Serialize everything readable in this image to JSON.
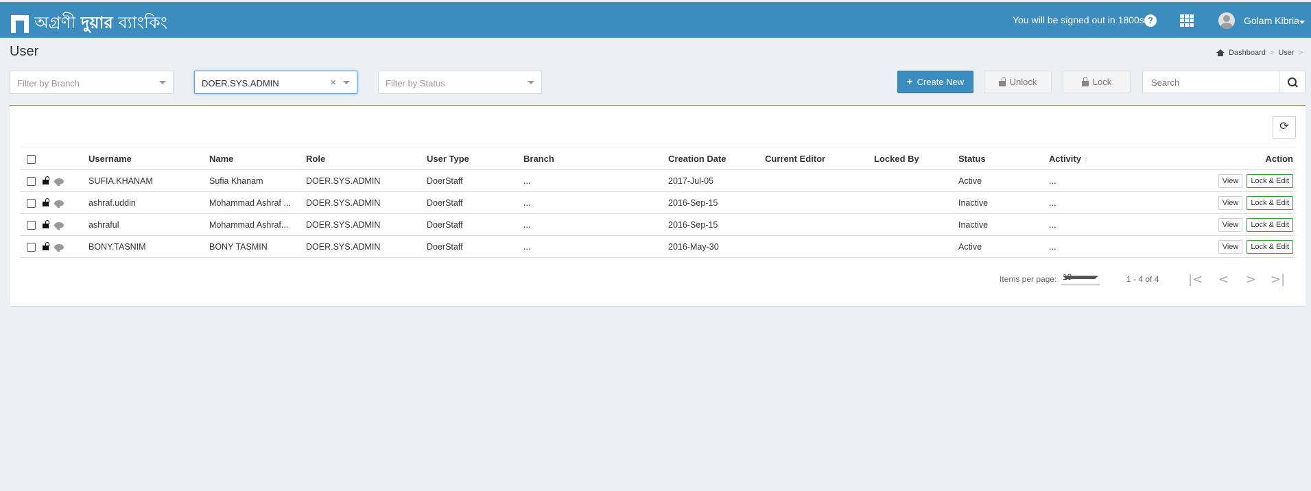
{
  "header": {
    "logo_text_1": "অগ্রণী",
    "logo_text_2": "দুয়ার",
    "logo_text_3": "ব্যাংকিং",
    "signout_text": "You will be signed out in 1800s",
    "help_label": "?",
    "user_name": "Golam Kibria"
  },
  "page": {
    "title": "User",
    "breadcrumb": [
      "Dashboard",
      "User"
    ],
    "breadcrumb_sep": ">"
  },
  "filters": {
    "branch_placeholder": "Filter by Branch",
    "role_value": "DOER.SYS.ADMIN",
    "status_placeholder": "Filter by Status",
    "clear_label": "×"
  },
  "toolbar": {
    "create_label": "Create New",
    "unlock_label": "Unlock",
    "lock_label": "Lock",
    "search_placeholder": "Search"
  },
  "table": {
    "columns": [
      "Username",
      "Name",
      "Role",
      "User Type",
      "Branch",
      "Creation Date",
      "Current Editor",
      "Locked By",
      "Status",
      "Activity",
      "Action"
    ],
    "sort_indicator": "↑",
    "view_label": "View",
    "lock_edit_label": "Lock & Edit",
    "rows": [
      {
        "username": "SUFIA.KHANAM",
        "name": "Sufia Khanam",
        "role": "DOER.SYS.ADMIN",
        "user_type": "DoerStaff",
        "branch": "...",
        "creation_date": "2017-Jul-05",
        "current_editor": "",
        "locked_by": "",
        "status": "Active",
        "activity": "..."
      },
      {
        "username": "ashraf.uddin",
        "name": "Mohammad Ashraf ...",
        "role": "DOER.SYS.ADMIN",
        "user_type": "DoerStaff",
        "branch": "...",
        "creation_date": "2016-Sep-15",
        "current_editor": "",
        "locked_by": "",
        "status": "Inactive",
        "activity": "..."
      },
      {
        "username": "ashraful",
        "name": "Mohammad Ashraf...",
        "role": "DOER.SYS.ADMIN",
        "user_type": "DoerStaff",
        "branch": "...",
        "creation_date": "2016-Sep-15",
        "current_editor": "",
        "locked_by": "",
        "status": "Inactive",
        "activity": "..."
      },
      {
        "username": "BONY.TASNIM",
        "name": "BONY TASMIN",
        "role": "DOER.SYS.ADMIN",
        "user_type": "DoerStaff",
        "branch": "...",
        "creation_date": "2016-May-30",
        "current_editor": "",
        "locked_by": "",
        "status": "Active",
        "activity": "..."
      }
    ]
  },
  "pagination": {
    "items_per_page_label": "Items per page:",
    "items_per_page_value": "10",
    "range_text": "1 - 4 of 4"
  },
  "colors": {
    "brand": "#3c8dbf",
    "background": "#eceff4",
    "lock_edit_border": "#3a9a3a"
  }
}
